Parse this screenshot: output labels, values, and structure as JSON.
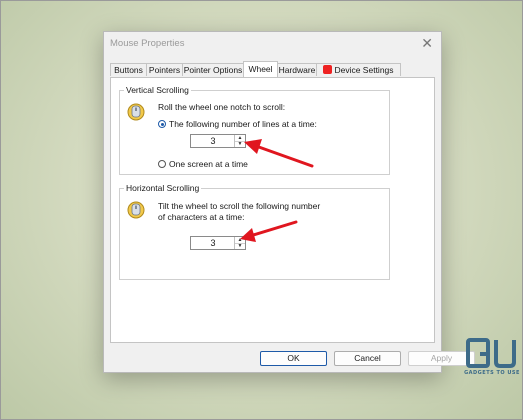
{
  "dialog": {
    "title": "Mouse Properties",
    "close_glyph": "✕",
    "tabs": [
      {
        "label": "Buttons",
        "selected": false
      },
      {
        "label": "Pointers",
        "selected": false
      },
      {
        "label": "Pointer Options",
        "selected": false
      },
      {
        "label": "Wheel",
        "selected": true
      },
      {
        "label": "Hardware",
        "selected": false
      },
      {
        "label": "Device Settings",
        "selected": false,
        "icon": "synaptics-icon"
      }
    ]
  },
  "vertical": {
    "group_label": "Vertical Scrolling",
    "instruction": "Roll the wheel one notch to scroll:",
    "option_lines": "The following number of lines at a time:",
    "option_lines_selected": true,
    "lines_value": "3",
    "option_screen": "One screen at a time",
    "option_screen_selected": false
  },
  "horizontal": {
    "group_label": "Horizontal Scrolling",
    "instruction_line1": "Tilt the wheel to scroll the following number",
    "instruction_line2": "of characters at a time:",
    "chars_value": "3"
  },
  "buttons": {
    "ok": "OK",
    "cancel": "Cancel",
    "apply": "Apply",
    "apply_enabled": false
  },
  "spin_glyphs": {
    "up": "▲",
    "down": "▼"
  },
  "watermark": {
    "mark": "GU",
    "caption": "GADGETS TO USE"
  },
  "colors": {
    "annotation_arrow": "#e0161f",
    "accent": "#1e5aa8",
    "watermark": "#3d6b89"
  }
}
